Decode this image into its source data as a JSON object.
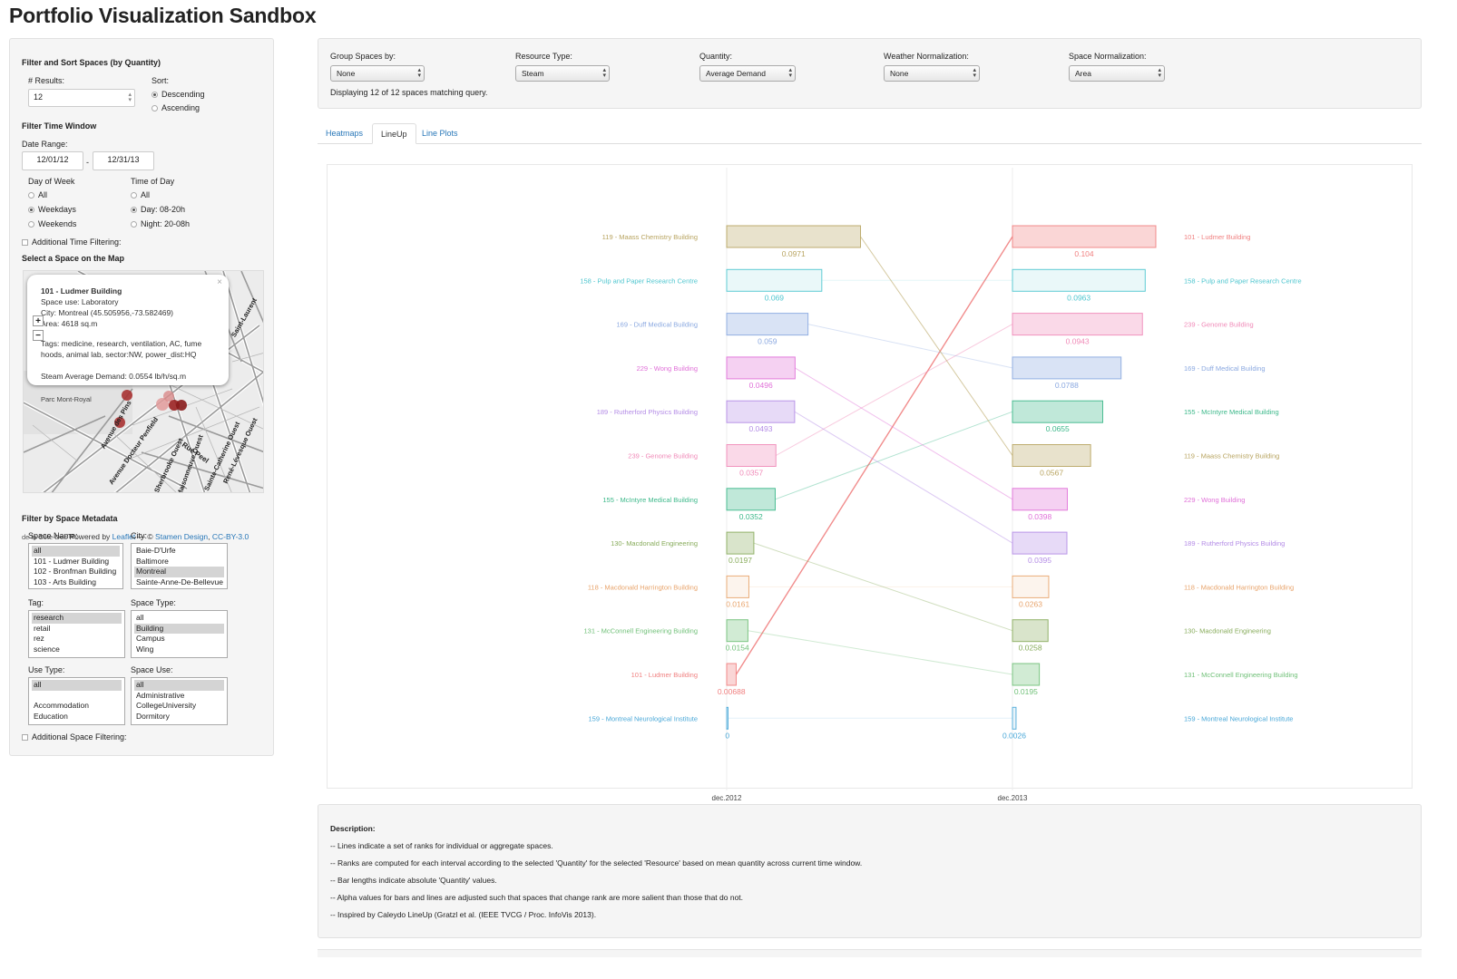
{
  "title": "Portfolio Visualization Sandbox",
  "filter_sort": {
    "heading": "Filter and Sort Spaces (by Quantity)",
    "results_label": "# Results:",
    "results_value": "12",
    "sort_label": "Sort:",
    "sort_options": [
      "Descending",
      "Ascending"
    ],
    "sort_selected": "Descending"
  },
  "time_window": {
    "heading": "Filter Time Window",
    "date_range_label": "Date Range:",
    "start_date": "12/01/12",
    "separator": "-",
    "end_date": "12/31/13",
    "day_of_week_label": "Day of Week",
    "day_of_week_options": [
      "All",
      "Weekdays",
      "Weekends"
    ],
    "day_of_week_selected": "Weekdays",
    "time_of_day_label": "Time of Day",
    "time_of_day_options": [
      "All",
      "Day: 08-20h",
      "Night: 20-08h"
    ],
    "time_of_day_selected": "Day: 08-20h",
    "additional_time_label": "Additional Time Filtering:"
  },
  "map": {
    "heading": "Select a Space on the Map",
    "popup": {
      "name": "101 - Ludmer Building",
      "space_use": "Space use: Laboratory",
      "city": "City: Montreal (45.505956,-73.582469)",
      "area": "Area: 4618 sq.m",
      "tags_line1": "Tags: medicine, research, ventilation, AC, fume",
      "tags_line2": "hoods, animal lab, sector:NW, power_dist:HQ",
      "demand": "Steam Average Demand: 0.0554 lb/h/sq.m",
      "close": "×"
    },
    "zoom_in": "+",
    "zoom_out": "−",
    "street_labels": [
      "Parc Mont-Royal",
      "Avenue des Pins",
      "Avenue Docteur Penfield",
      "Sherbrooke Ouest",
      "Rue Peel",
      "Maisonneuve Ouest",
      "Sainte-Catherine Ouest",
      "René-Lévesque Ouest",
      "Saint-Laurent"
    ],
    "attrib_prefix": "de la Côte-Des",
    "attrib_powered": "Powered by ",
    "attrib_leaflet": "Leaflet",
    "attrib_dash": " — © ",
    "attrib_stamen": "Stamen Design",
    "attrib_sep": ", ",
    "attrib_cc": "CC-BY-3.0"
  },
  "metadata": {
    "heading": "Filter by Space Metadata",
    "space_name_label": "Space Name:",
    "space_name_items": [
      "all",
      "101 - Ludmer Building",
      "102 - Bronfman Building",
      "103 - Arts Building"
    ],
    "city_label": "City:",
    "city_items": [
      "Baie-D'Urfe",
      "Baltimore",
      "Montreal",
      "Sainte-Anne-De-Bellevue"
    ],
    "tag_label": "Tag:",
    "tag_items": [
      "research",
      "retail",
      "rez",
      "science"
    ],
    "space_type_label": "Space Type:",
    "space_type_items": [
      "all",
      "Building",
      "Campus",
      "Wing"
    ],
    "use_type_label": "Use Type:",
    "use_type_items": [
      "all",
      "",
      "Accommodation",
      "Education"
    ],
    "space_use_label": "Space Use:",
    "space_use_items": [
      "all",
      "Administrative",
      "CollegeUniversity",
      "Dormitory"
    ],
    "additional_space_label": "Additional Space Filtering:"
  },
  "controls": {
    "group_by_label": "Group Spaces by:",
    "group_by_value": "None",
    "resource_label": "Resource Type:",
    "resource_value": "Steam",
    "quantity_label": "Quantity:",
    "quantity_value": "Average Demand",
    "weather_label": "Weather Normalization:",
    "weather_value": "None",
    "space_norm_label": "Space Normalization:",
    "space_norm_value": "Area",
    "status": "Displaying 12 of 12 spaces matching query."
  },
  "tabs": [
    "Heatmaps",
    "LineUp",
    "Line Plots"
  ],
  "active_tab": "LineUp",
  "chart_data": {
    "type": "lineup",
    "columns": [
      "dec.2012",
      "dec.2013"
    ],
    "xmax": 0.104,
    "series": [
      {
        "name": "101 - Ludmer Building",
        "color": "#f08080",
        "values": [
          0.00688,
          0.104
        ],
        "labels": [
          "0.00688",
          "0.104"
        ]
      },
      {
        "name": "158 - Pulp and Paper Research Centre",
        "color": "#4fc6cf",
        "values": [
          0.069,
          0.0963
        ],
        "labels": [
          "0.069",
          "0.0963"
        ]
      },
      {
        "name": "239  - Genome Building",
        "color": "#f08ab8",
        "values": [
          0.0357,
          0.0943
        ],
        "labels": [
          "0.0357",
          "0.0943"
        ]
      },
      {
        "name": "169 - Duff Medical Building",
        "color": "#8aa8e0",
        "values": [
          0.059,
          0.0788
        ],
        "labels": [
          "0.059",
          "0.0788"
        ]
      },
      {
        "name": "155 - McIntyre Medical Building",
        "color": "#3cb88a",
        "values": [
          0.0352,
          0.0655
        ],
        "labels": [
          "0.0352",
          "0.0655"
        ]
      },
      {
        "name": "119 - Maass Chemistry Building",
        "color": "#b8a460",
        "values": [
          0.0971,
          0.0567
        ],
        "labels": [
          "0.0971",
          "0.0567"
        ]
      },
      {
        "name": "229 - Wong Building",
        "color": "#e070d8",
        "values": [
          0.0496,
          0.0398
        ],
        "labels": [
          "0.0496",
          "0.0398"
        ]
      },
      {
        "name": "189 - Rutherford Physics Building",
        "color": "#b48ce6",
        "values": [
          0.0493,
          0.0395
        ],
        "labels": [
          "0.0493",
          "0.0395"
        ]
      },
      {
        "name": "118 - Macdonald Harrington Building",
        "color": "#e8a46c",
        "values": [
          0.0161,
          0.0263
        ],
        "labels": [
          "0.0161",
          "0.0263"
        ]
      },
      {
        "name": "130- Macdonald Engineering",
        "color": "#88ac5c",
        "values": [
          0.0197,
          0.0258
        ],
        "labels": [
          "0.0197",
          "0.0258"
        ]
      },
      {
        "name": "131 - McConnell Engineering Building",
        "color": "#70c078",
        "values": [
          0.0154,
          0.0195
        ],
        "labels": [
          "0.0154",
          "0.0195"
        ]
      },
      {
        "name": "159 - Montreal Neurological Institute",
        "color": "#4aa8d8",
        "values": [
          0,
          0.0026
        ],
        "labels": [
          "0",
          "0.0026"
        ]
      }
    ],
    "rank_2012": [
      "119 - Maass Chemistry Building",
      "158 - Pulp and Paper Research Centre",
      "169 - Duff Medical Building",
      "229 - Wong Building",
      "189 - Rutherford Physics Building",
      "239  - Genome Building",
      "155 - McIntyre Medical Building",
      "130- Macdonald Engineering",
      "118 - Macdonald Harrington Building",
      "131 - McConnell Engineering Building",
      "101 - Ludmer Building",
      "159 - Montreal Neurological Institute"
    ],
    "rank_2013": [
      "101 - Ludmer Building",
      "158 - Pulp and Paper Research Centre",
      "239  - Genome Building",
      "169 - Duff Medical Building",
      "155 - McIntyre Medical Building",
      "119 - Maass Chemistry Building",
      "229 - Wong Building",
      "189 - Rutherford Physics Building",
      "118 - Macdonald Harrington Building",
      "130- Macdonald Engineering",
      "131 - McConnell Engineering Building",
      "159 - Montreal Neurological Institute"
    ]
  },
  "description": {
    "heading": "Description:",
    "lines": [
      "-- Lines indicate a set of ranks for individual or aggregate spaces.",
      "-- Ranks are computed for each interval according to the selected 'Quantity' for the selected 'Resource' based on mean quantity across current time window.",
      "-- Bar lengths indicate absolute 'Quantity' values.",
      "-- Alpha values for bars and lines are adjusted such that spaces that change rank are more salient than those that do not.",
      "-- Inspired by Caleydo LineUp (Gratzl et al. (IEEE TVCG / Proc. InfoVis 2013)."
    ]
  }
}
